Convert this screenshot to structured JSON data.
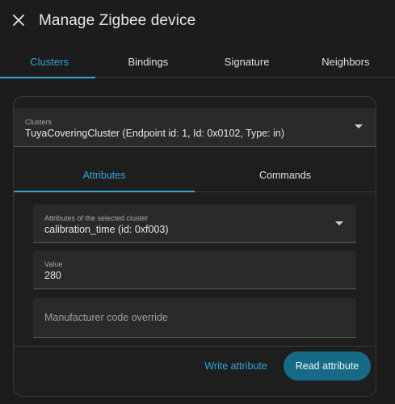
{
  "dialog": {
    "title": "Manage Zigbee device",
    "close_icon": "close-icon"
  },
  "tabs": [
    {
      "label": "Clusters",
      "active": true
    },
    {
      "label": "Bindings",
      "active": false
    },
    {
      "label": "Signature",
      "active": false
    },
    {
      "label": "Neighbors",
      "active": false
    }
  ],
  "clusters": {
    "label": "Clusters",
    "value": "TuyaCoveringCluster (Endpoint id: 1, Id: 0x0102, Type: in)"
  },
  "inner_tabs": [
    {
      "label": "Attributes",
      "active": true
    },
    {
      "label": "Commands",
      "active": false
    }
  ],
  "attributes_select": {
    "label": "Attributes of the selected cluster",
    "value": "calibration_time (id: 0xf003)"
  },
  "value_field": {
    "label": "Value",
    "value": "280"
  },
  "manufacturer_field": {
    "placeholder": "Manufacturer code override"
  },
  "actions": {
    "write": "Write attribute",
    "read": "Read attribute"
  },
  "colors": {
    "accent": "#2fa6d6",
    "primary_button": "#176a86",
    "background": "#1c1c1c",
    "field": "#2a2a2a"
  }
}
